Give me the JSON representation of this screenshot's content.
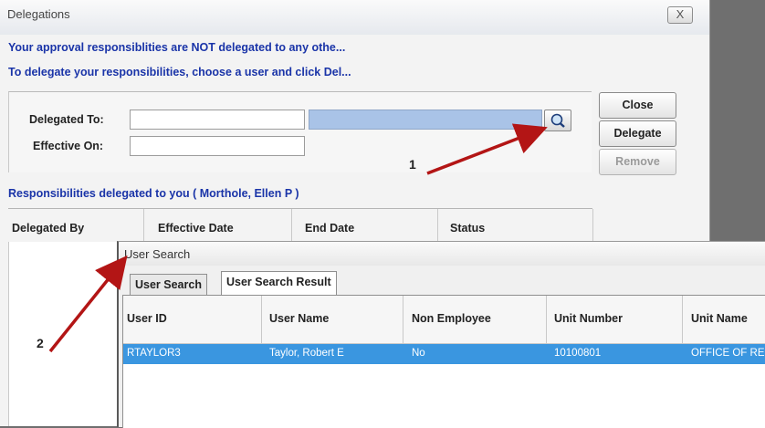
{
  "delegations": {
    "title": "Delegations",
    "close_glyph": "X",
    "info_line1": "Your approval responsiblities are NOT delegated to any othe...",
    "info_line2": "To delegate your responsibilities, choose a user and click Del...",
    "delegated_to_label": "Delegated To:",
    "delegated_to_value": "",
    "effective_on_label": "Effective On:",
    "effective_on_value": "",
    "buttons": {
      "close": "Close",
      "delegate": "Delegate",
      "remove": "Remove"
    },
    "responsibilities_label": "Responsibilities delegated to you ( Morthole, Ellen P )",
    "grid_columns": [
      "Delegated By",
      "Effective Date",
      "End Date",
      "Status"
    ]
  },
  "user_search": {
    "title": "User Search",
    "tabs": [
      "User Search",
      "User Search Result"
    ],
    "columns": [
      "User ID",
      "User Name",
      "Non Employee",
      "Unit Number",
      "Unit Name"
    ],
    "rows": [
      {
        "user_id": "RTAYLOR3",
        "user_name": "Taylor, Robert E",
        "non_employee": "No",
        "unit_number": "10100801",
        "unit_name": "OFFICE OF RE"
      }
    ]
  },
  "annotations": {
    "step1": "1",
    "step2": "2"
  },
  "colors": {
    "accent_text": "#1a34a8",
    "selected_row": "#3a96e0",
    "arrow": "#b31515"
  },
  "icons": {
    "search": "magnifier-icon"
  }
}
